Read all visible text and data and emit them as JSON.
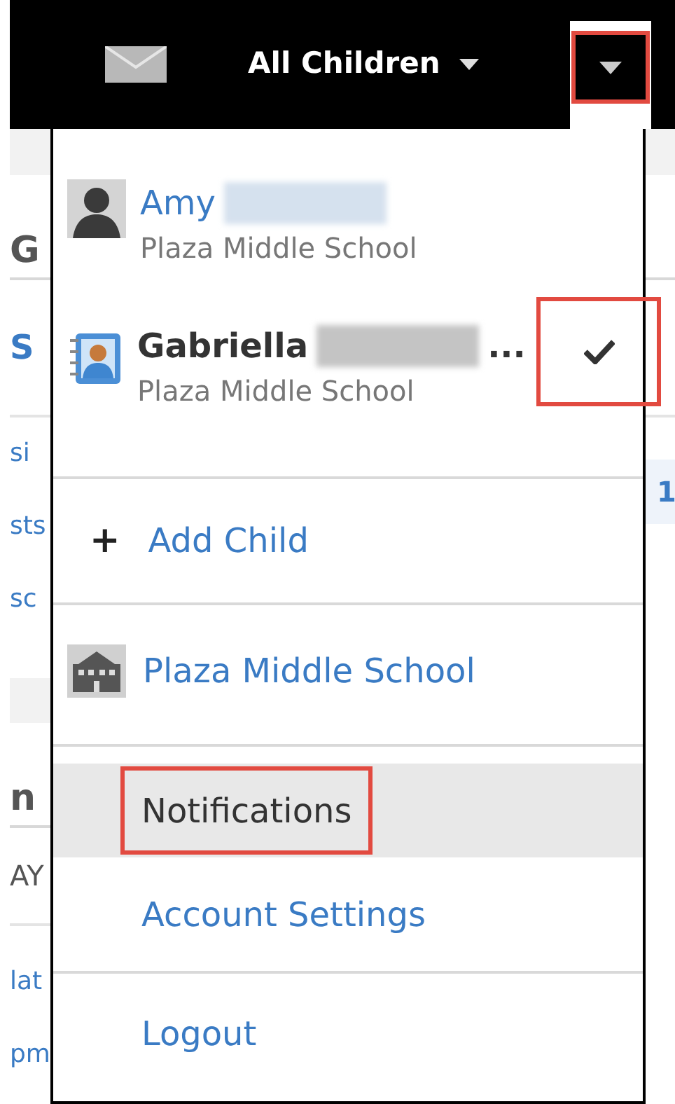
{
  "top_bar": {
    "title": "All Children",
    "menu_button": {
      "expanded": true,
      "highlighted": true
    }
  },
  "background_left": [
    {
      "kind": "band"
    },
    {
      "kind": "heading",
      "text": "G"
    },
    {
      "kind": "strong_link",
      "text": "S"
    },
    {
      "kind": "link",
      "text": "si"
    },
    {
      "kind": "link",
      "text": "sts"
    },
    {
      "kind": "link",
      "text": "sc"
    },
    {
      "kind": "band"
    },
    {
      "kind": "heading",
      "text": "n"
    },
    {
      "kind": "text",
      "text": "AY"
    },
    {
      "kind": "link",
      "text": "lat"
    },
    {
      "kind": "link",
      "text": "pm"
    }
  ],
  "background_right": {
    "count": "1"
  },
  "dropdown": {
    "children": [
      {
        "name": "Amy",
        "school": "Plaza Middle School",
        "kind": "silhouette",
        "selected": false
      },
      {
        "name": "Gabriella",
        "overflow": "...",
        "school": "Plaza Middle School",
        "kind": "photo",
        "selected": true,
        "check_highlighted": true
      }
    ],
    "add_child": {
      "icon": "+",
      "label": "Add Child"
    },
    "school": {
      "label": "Plaza Middle School"
    },
    "links": [
      {
        "label": "Notifications",
        "hovered": true,
        "highlighted": true
      },
      {
        "label": "Account Settings",
        "hovered": false,
        "highlighted": false
      }
    ],
    "logout": {
      "label": "Logout"
    }
  }
}
